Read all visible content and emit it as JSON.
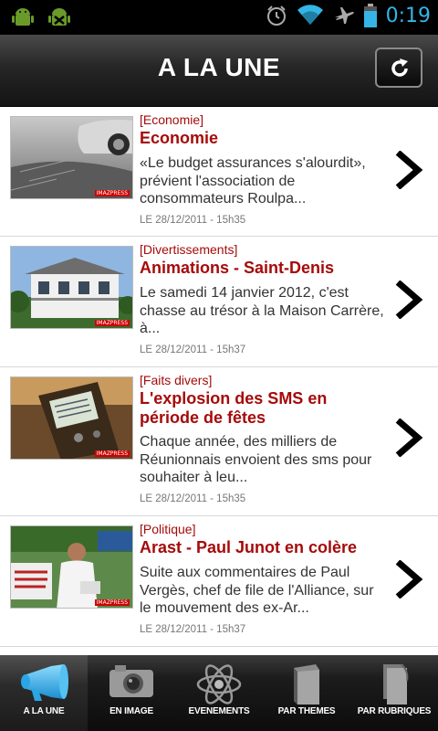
{
  "status_bar": {
    "time": "0:19"
  },
  "header": {
    "title": "A LA UNE"
  },
  "articles": [
    {
      "category": "[Economie]",
      "title": "Economie",
      "summary": "«Le budget assurances s'alourdit», prévient l'association de consommateurs Roulpa...",
      "date": "LE 28/12/2011 - 15h35"
    },
    {
      "category": "[Divertissements]",
      "title": "Animations - Saint-Denis",
      "summary": "Le samedi 14 janvier 2012, c'est chasse au trésor à la Maison Carrère, à...",
      "date": "LE 28/12/2011 - 15h37"
    },
    {
      "category": "[Faits divers]",
      "title": "L'explosion des SMS en période de fêtes",
      "summary": "Chaque année, des milliers de Réunionnais envoient des sms pour souhaiter à leu...",
      "date": "LE 28/12/2011 - 15h35"
    },
    {
      "category": "[Politique]",
      "title": "Arast - Paul Junot en colère",
      "summary": "Suite aux commentaires de Paul Vergès, chef de file de l'Alliance, sur le mouvement des ex-Ar...",
      "date": "LE 28/12/2011 - 15h37"
    }
  ],
  "tabs": [
    {
      "label": "A LA UNE",
      "icon": "megaphone-icon",
      "active": true
    },
    {
      "label": "EN IMAGE",
      "icon": "camera-icon",
      "active": false
    },
    {
      "label": "EVENEMENTS",
      "icon": "atom-icon",
      "active": false
    },
    {
      "label": "PAR THEMES",
      "icon": "book-icon",
      "active": false
    },
    {
      "label": "PAR RUBRIQUES",
      "icon": "document-icon",
      "active": false
    }
  ],
  "colors": {
    "accent_red": "#a60a0a",
    "time_blue": "#35b5e5"
  }
}
